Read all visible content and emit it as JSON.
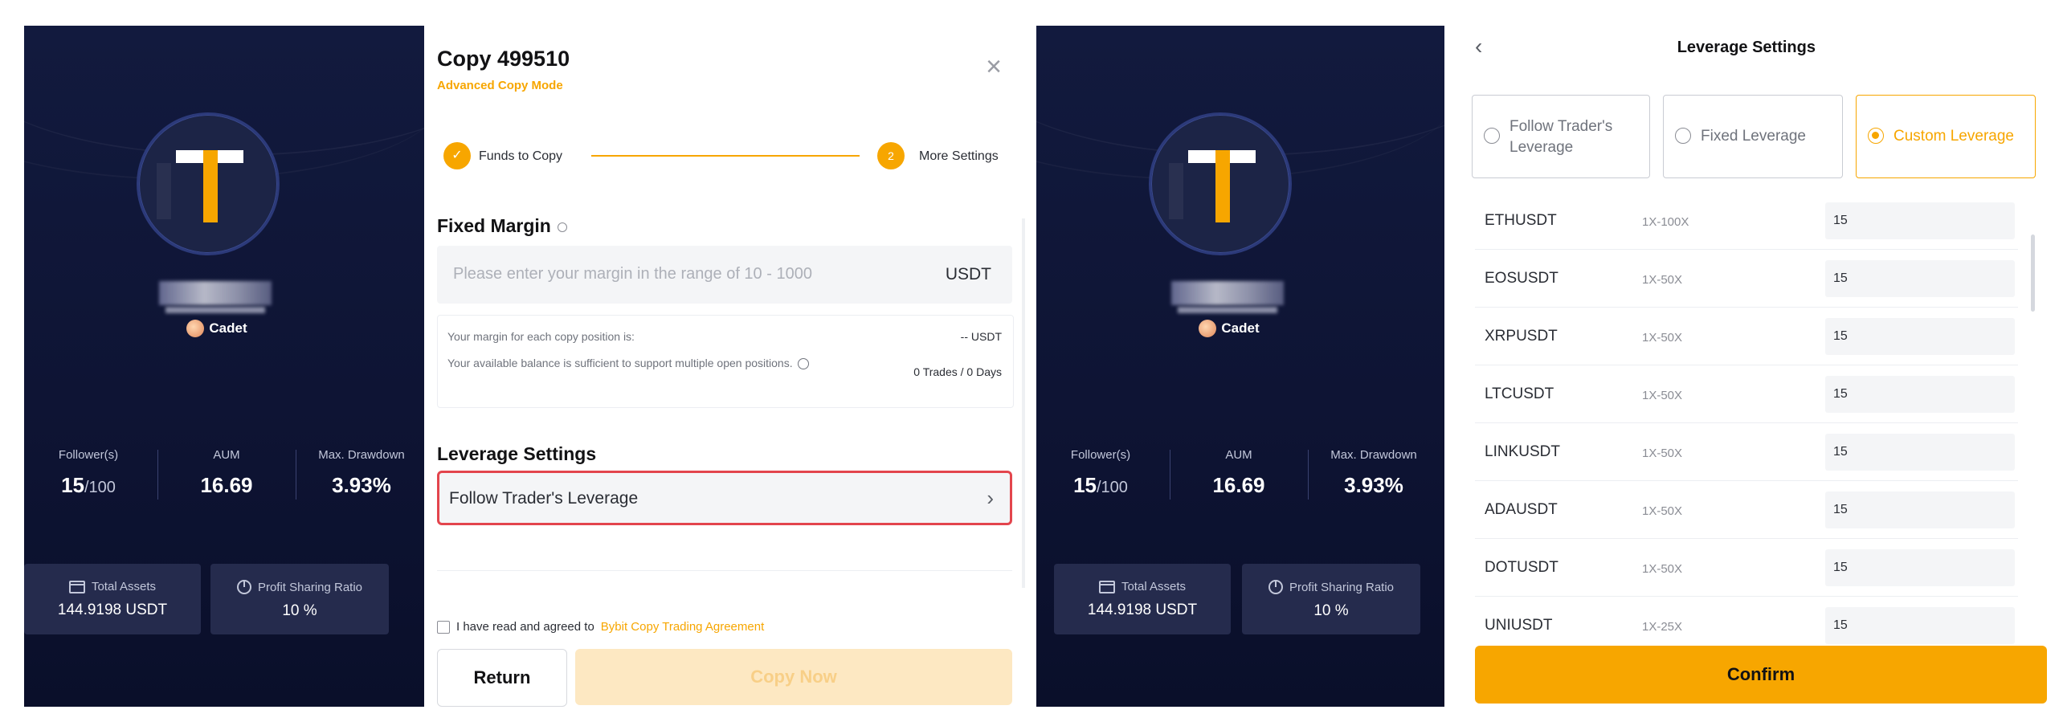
{
  "left_trader": {
    "rank": "Cadet",
    "stats": {
      "followers_label": "Follower(s)",
      "followers_value": "15",
      "followers_cap": "/100",
      "aum_label": "AUM",
      "aum_value": "16.69",
      "drawdown_label": "Max. Drawdown",
      "drawdown_value": "3.93%"
    },
    "total_assets_label": "Total Assets",
    "total_assets_value": "144.9198 USDT",
    "profit_share_label": "Profit Sharing Ratio",
    "profit_share_value": "10 %"
  },
  "copy_modal": {
    "title": "Copy 499510",
    "subtitle": "Advanced Copy Mode",
    "close_symbol": "×",
    "step1_check": "✓",
    "step1_label": "Funds to Copy",
    "step2_number": "2",
    "step2_label": "More Settings",
    "fixed_margin_title": "Fixed Margin",
    "margin_placeholder": "Please enter your margin in the range of 10 - 1000",
    "margin_unit": "USDT",
    "info_line1": "Your margin for each copy position is:",
    "info_value1": "-- USDT",
    "info_line2": "Your available balance is sufficient to support multiple open positions.",
    "info_value2": "0 Trades / 0 Days",
    "leverage_title": "Leverage Settings",
    "leverage_option": "Follow Trader's Leverage",
    "leverage_chevron": "›",
    "agree_text": "I have read and agreed to",
    "agree_link": "Bybit Copy Trading Agreement",
    "return_label": "Return",
    "copy_now_label": "Copy Now"
  },
  "right_trader": {
    "rank": "Cadet",
    "stats": {
      "followers_label": "Follower(s)",
      "followers_value": "15",
      "followers_cap": "/100",
      "aum_label": "AUM",
      "aum_value": "16.69",
      "drawdown_label": "Max. Drawdown",
      "drawdown_value": "3.93%"
    },
    "total_assets_label": "Total Assets",
    "total_assets_value": "144.9198 USDT",
    "profit_share_label": "Profit Sharing Ratio",
    "profit_share_value": "10 %"
  },
  "leverage_settings": {
    "back_symbol": "‹",
    "title": "Leverage Settings",
    "options": [
      "Follow Trader's Leverage",
      "Fixed Leverage",
      "Custom Leverage"
    ],
    "selected_option": "Custom Leverage",
    "pairs": [
      {
        "symbol": "ETHUSDT",
        "range": "1X-100X",
        "value": "15"
      },
      {
        "symbol": "EOSUSDT",
        "range": "1X-50X",
        "value": "15"
      },
      {
        "symbol": "XRPUSDT",
        "range": "1X-50X",
        "value": "15"
      },
      {
        "symbol": "LTCUSDT",
        "range": "1X-50X",
        "value": "15"
      },
      {
        "symbol": "LINKUSDT",
        "range": "1X-50X",
        "value": "15"
      },
      {
        "symbol": "ADAUSDT",
        "range": "1X-50X",
        "value": "15"
      },
      {
        "symbol": "DOTUSDT",
        "range": "1X-50X",
        "value": "15"
      },
      {
        "symbol": "UNIUSDT",
        "range": "1X-25X",
        "value": "15"
      }
    ],
    "confirm_label": "Confirm"
  },
  "colors": {
    "accent": "#f7a600",
    "highlight_border": "#e3454d",
    "trader_bg": "#121a3e"
  }
}
